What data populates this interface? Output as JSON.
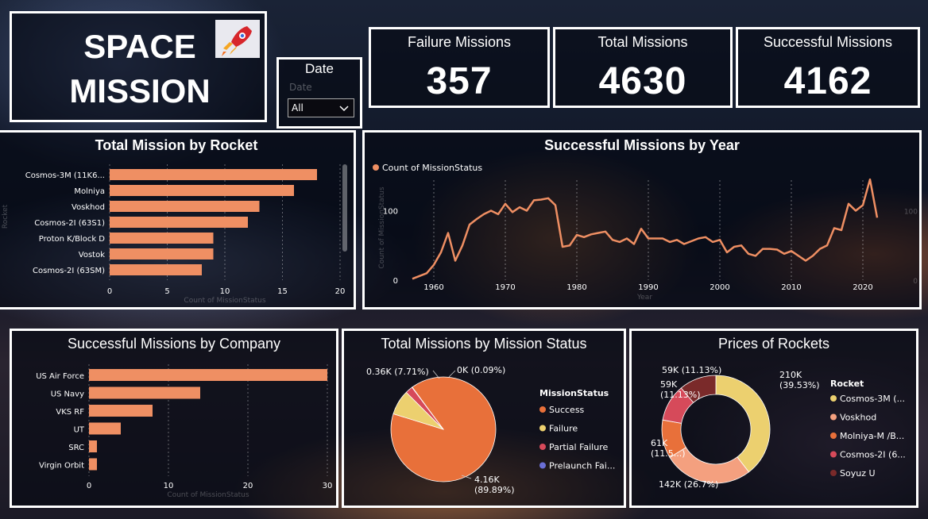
{
  "title": {
    "line1": "SPACE",
    "line2": "MISSION",
    "icon": "rocket-icon"
  },
  "slicer": {
    "title": "Date",
    "label": "Date",
    "value": "All"
  },
  "cards": [
    {
      "title": "Failure Missions",
      "value": "357"
    },
    {
      "title": "Total Missions",
      "value": "4630"
    },
    {
      "title": "Successful Missions",
      "value": "4162"
    }
  ],
  "colors": {
    "bar": "#ef8f63",
    "success": "#e8703a",
    "failure": "#ecd06f",
    "partial": "#d64a5a",
    "prelaunch": "#6b6fd6"
  },
  "chart_data": [
    {
      "type": "bar",
      "title": "Total Mission by Rocket",
      "orientation": "horizontal",
      "categories": [
        "Cosmos-3M (11K6...",
        "Molniya",
        "Voskhod",
        "Cosmos-2I (63S1)",
        "Proton K/Block D",
        "Vostok",
        "Cosmos-2I (63SM)"
      ],
      "values": [
        18,
        16,
        13,
        12,
        9,
        9,
        8
      ],
      "xticks": [
        "0",
        "5",
        "10",
        "15",
        "20"
      ],
      "xlim": [
        0,
        20
      ],
      "xlabel": "Count of MissionStatus",
      "ylabel": "Rocket"
    },
    {
      "type": "line",
      "title": "Successful Missions by Year",
      "series": [
        {
          "name": "Count of MissionStatus",
          "x": [
            1957,
            1958,
            1959,
            1960,
            1961,
            1962,
            1963,
            1964,
            1965,
            1966,
            1967,
            1968,
            1969,
            1970,
            1971,
            1972,
            1973,
            1974,
            1975,
            1976,
            1977,
            1978,
            1979,
            1980,
            1981,
            1982,
            1983,
            1984,
            1985,
            1986,
            1987,
            1988,
            1989,
            1990,
            1991,
            1992,
            1993,
            1994,
            1995,
            1996,
            1997,
            1998,
            1999,
            2000,
            2001,
            2002,
            2003,
            2004,
            2005,
            2006,
            2007,
            2008,
            2009,
            2010,
            2011,
            2012,
            2013,
            2014,
            2015,
            2016,
            2017,
            2018,
            2019,
            2020,
            2021,
            2022
          ],
          "y": [
            2,
            6,
            10,
            22,
            40,
            68,
            28,
            50,
            80,
            88,
            95,
            100,
            95,
            110,
            98,
            105,
            100,
            115,
            116,
            118,
            108,
            48,
            50,
            65,
            62,
            66,
            68,
            70,
            58,
            55,
            60,
            52,
            74,
            60,
            60,
            60,
            55,
            58,
            52,
            56,
            60,
            62,
            55,
            58,
            40,
            48,
            50,
            38,
            35,
            45,
            45,
            44,
            38,
            42,
            35,
            28,
            35,
            45,
            50,
            75,
            72,
            110,
            100,
            108,
            145,
            90
          ]
        }
      ],
      "xticks": [
        "1960",
        "1970",
        "1980",
        "1990",
        "2000",
        "2010",
        "2020"
      ],
      "yticks": [
        "0",
        "100"
      ],
      "ylim": [
        0,
        160
      ],
      "xlabel": "Year",
      "ylabel": "Count of MissionStatus"
    },
    {
      "type": "bar",
      "title": "Successful Missions by Company",
      "orientation": "horizontal",
      "categories": [
        "US Air Force",
        "US Navy",
        "VKS RF",
        "UT",
        "SRC",
        "Virgin Orbit"
      ],
      "values": [
        30,
        14,
        8,
        4,
        1,
        1
      ],
      "xticks": [
        "0",
        "10",
        "20",
        "30"
      ],
      "xlim": [
        0,
        30
      ],
      "xlabel": "Count of MissionStatus"
    },
    {
      "type": "pie",
      "title": "Total Missions by Mission Status",
      "legend_title": "MissionStatus",
      "labels": [
        "Success",
        "Failure",
        "Partial Failure",
        "Prelaunch Fai..."
      ],
      "values": [
        4162,
        357,
        107,
        4
      ],
      "data_labels": [
        "4.16K\n(89.89%)",
        "0.36K (7.71%)",
        "",
        "0K (0.09%)"
      ]
    },
    {
      "type": "pie",
      "subtype": "donut",
      "title": "Prices of Rockets",
      "legend_title": "Rocket",
      "labels": [
        "Cosmos-3M (...",
        "Voskhod",
        "Molniya-M /B...",
        "Cosmos-2I (6...",
        "Soyuz U"
      ],
      "values": [
        210,
        142,
        61,
        59,
        59
      ],
      "data_labels": [
        "210K\n(39.53%)",
        "142K (26.7%)",
        "61K\n(11.5...)",
        "59K\n(11.13%)",
        "59K (11.13%)"
      ],
      "colors": [
        "#ecd06f",
        "#f4a07f",
        "#e8703a",
        "#d64a5a",
        "#7a2a2a"
      ]
    }
  ]
}
